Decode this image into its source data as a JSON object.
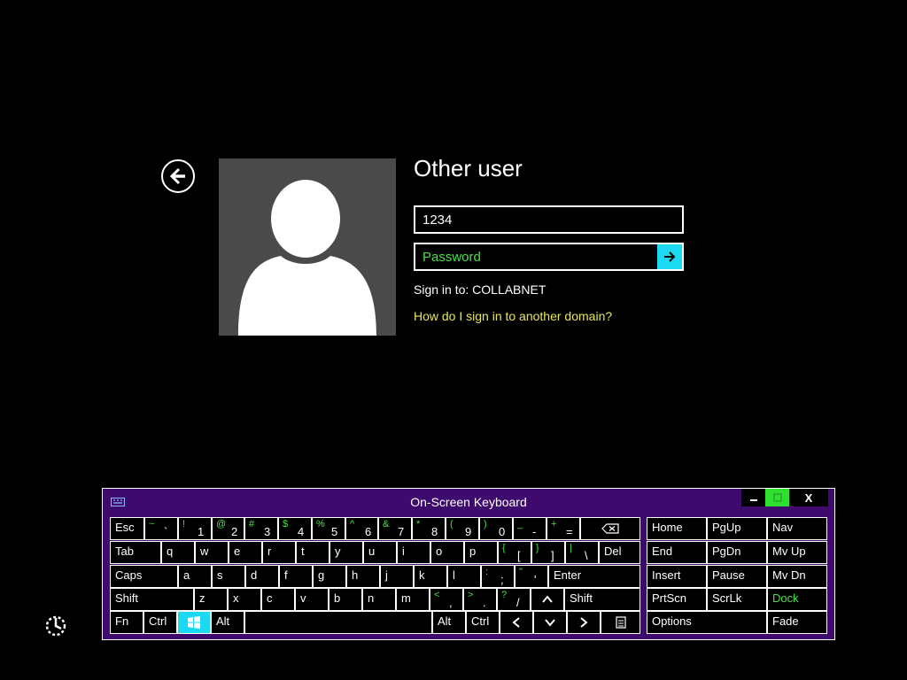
{
  "login": {
    "title": "Other user",
    "username_value": "1234",
    "password_placeholder": "Password",
    "sign_in_to": "Sign in to: COLLABNET",
    "domain_help_link": "How do I sign in to another domain?",
    "accent_color": "#1ad9f0"
  },
  "osk": {
    "title": "On-Screen Keyboard",
    "window_buttons": [
      "minimize",
      "restore",
      "X"
    ],
    "close_label": "X",
    "colors": {
      "background": "#3e0a6e",
      "shift_glyph": "#46e046",
      "highlight": "#1ad9f0",
      "restore": "#2de02d"
    },
    "rows": [
      [
        {
          "label": "Esc"
        },
        {
          "shift": "~",
          "base": "`"
        },
        {
          "shift": "!",
          "base": "1"
        },
        {
          "shift": "@",
          "base": "2"
        },
        {
          "shift": "#",
          "base": "3"
        },
        {
          "shift": "$",
          "base": "4"
        },
        {
          "shift": "%",
          "base": "5"
        },
        {
          "shift": "^",
          "base": "6"
        },
        {
          "shift": "&",
          "base": "7"
        },
        {
          "shift": "*",
          "base": "8"
        },
        {
          "shift": "(",
          "base": "9"
        },
        {
          "shift": ")",
          "base": "0"
        },
        {
          "shift": "_",
          "base": "-"
        },
        {
          "shift": "+",
          "base": "="
        },
        {
          "icon": "backspace-icon"
        }
      ],
      [
        {
          "label": "Tab"
        },
        {
          "label": "q"
        },
        {
          "label": "w"
        },
        {
          "label": "e"
        },
        {
          "label": "r"
        },
        {
          "label": "t"
        },
        {
          "label": "y"
        },
        {
          "label": "u"
        },
        {
          "label": "i"
        },
        {
          "label": "o"
        },
        {
          "label": "p"
        },
        {
          "shift": "{",
          "base": "["
        },
        {
          "shift": "}",
          "base": "]"
        },
        {
          "shift": "|",
          "base": "\\"
        },
        {
          "label": "Del"
        }
      ],
      [
        {
          "label": "Caps"
        },
        {
          "label": "a"
        },
        {
          "label": "s"
        },
        {
          "label": "d"
        },
        {
          "label": "f"
        },
        {
          "label": "g"
        },
        {
          "label": "h"
        },
        {
          "label": "j"
        },
        {
          "label": "k"
        },
        {
          "label": "l"
        },
        {
          "shift": ":",
          "base": ";"
        },
        {
          "shift": "\"",
          "base": "'"
        },
        {
          "label": "Enter"
        }
      ],
      [
        {
          "label": "Shift"
        },
        {
          "label": "z"
        },
        {
          "label": "x"
        },
        {
          "label": "c"
        },
        {
          "label": "v"
        },
        {
          "label": "b"
        },
        {
          "label": "n"
        },
        {
          "label": "m"
        },
        {
          "shift": "<",
          "base": ","
        },
        {
          "shift": ">",
          "base": "."
        },
        {
          "shift": "?",
          "base": "/"
        },
        {
          "icon": "arrow-up-icon"
        },
        {
          "label": "Shift"
        }
      ],
      [
        {
          "label": "Fn"
        },
        {
          "label": "Ctrl"
        },
        {
          "icon": "windows-icon"
        },
        {
          "label": "Alt"
        },
        {
          "label": ""
        },
        {
          "label": "Alt"
        },
        {
          "label": "Ctrl"
        },
        {
          "icon": "arrow-left-icon"
        },
        {
          "icon": "arrow-down-icon"
        },
        {
          "icon": "arrow-right-icon"
        },
        {
          "icon": "menu-icon"
        }
      ]
    ],
    "side": [
      [
        "Home",
        "PgUp",
        "Nav"
      ],
      [
        "End",
        "PgDn",
        "Mv Up"
      ],
      [
        "Insert",
        "Pause",
        "Mv Dn"
      ],
      [
        "PrtScn",
        "ScrLk",
        "Dock"
      ],
      [
        "Options",
        "Fade"
      ]
    ]
  }
}
